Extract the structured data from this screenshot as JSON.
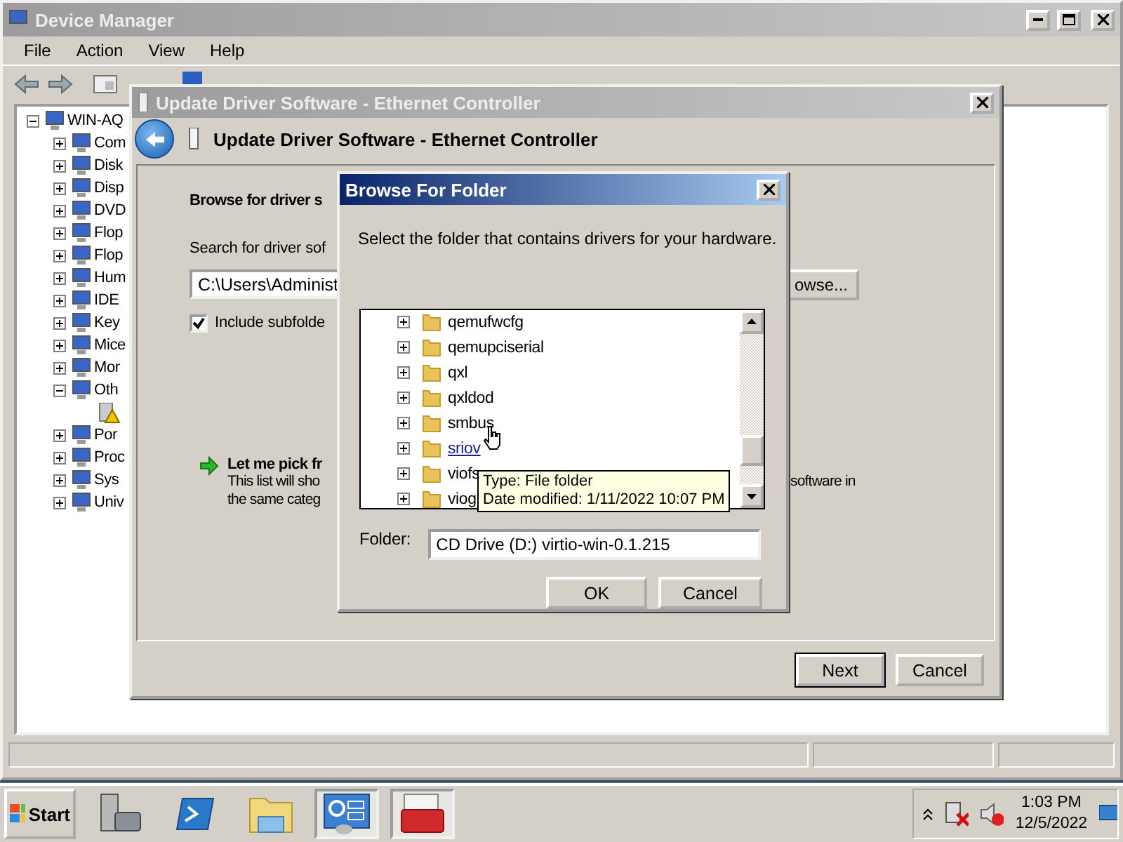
{
  "device_manager": {
    "title": "Device Manager",
    "menu": [
      "File",
      "Action",
      "View",
      "Help"
    ],
    "tree": {
      "label": "WIN-AQ",
      "expanded": true,
      "children": [
        {
          "label": "Com",
          "expanded": false
        },
        {
          "label": "Disk",
          "expanded": false
        },
        {
          "label": "Disp",
          "expanded": false
        },
        {
          "label": "DVD",
          "expanded": false
        },
        {
          "label": "Flop",
          "expanded": false
        },
        {
          "label": "Flop",
          "expanded": false
        },
        {
          "label": "Hum",
          "expanded": false
        },
        {
          "label": "IDE",
          "expanded": false
        },
        {
          "label": "Key",
          "expanded": false
        },
        {
          "label": "Mice",
          "expanded": false
        },
        {
          "label": "Mor",
          "expanded": false
        },
        {
          "label": "Oth",
          "expanded": true,
          "children": [
            {
              "warning": true
            }
          ]
        },
        {
          "label": "Por",
          "expanded": false
        },
        {
          "label": "Proc",
          "expanded": false
        },
        {
          "label": "Sys",
          "expanded": false
        },
        {
          "label": "Univ",
          "expanded": false
        }
      ]
    }
  },
  "update_driver": {
    "title": "Update Driver Software - Ethernet Controller",
    "heading": "Update Driver Software - Ethernet Controller",
    "section_title": "Browse for driver s",
    "search_label": "Search for driver sof",
    "path_value": "C:\\Users\\Administ",
    "browse_button": "owse...",
    "include_subfolders": {
      "label": "Include subfolde",
      "checked": true
    },
    "pick_option": {
      "title": "Let me pick fr",
      "lines": [
        "This list will sho",
        "the same categ"
      ],
      "tail": "software in"
    },
    "buttons": [
      "Next",
      "Cancel"
    ]
  },
  "browse_dialog": {
    "title": "Browse For Folder",
    "prompt": "Select the folder that contains drivers for your hardware.",
    "folders": [
      {
        "label": "qemufwcfg",
        "hovered": false
      },
      {
        "label": "qemupciserial",
        "hovered": false
      },
      {
        "label": "qxl",
        "hovered": false
      },
      {
        "label": "qxldod",
        "hovered": false
      },
      {
        "label": "smbus",
        "hovered": false
      },
      {
        "label": "sriov",
        "hovered": true
      },
      {
        "label": "viofs",
        "hovered": false
      },
      {
        "label": "viog",
        "hovered": false
      }
    ],
    "tooltip": [
      "Type: File folder",
      "Date modified: 1/11/2022 10:07 PM"
    ],
    "folder_label": "Folder:",
    "folder_value": "CD Drive (D:) virtio-win-0.1.215",
    "buttons": [
      "OK",
      "Cancel"
    ]
  },
  "taskbar": {
    "start": "Start",
    "apps": [
      {
        "kind": "server",
        "running": false
      },
      {
        "kind": "terminal",
        "running": false
      },
      {
        "kind": "folder",
        "running": false
      },
      {
        "kind": "dashboard",
        "running": true
      },
      {
        "kind": "toolbox",
        "running": true
      }
    ],
    "tray": {
      "network_connected": false,
      "muted": true,
      "time": "1:03 PM",
      "date": "12/5/2022"
    }
  }
}
